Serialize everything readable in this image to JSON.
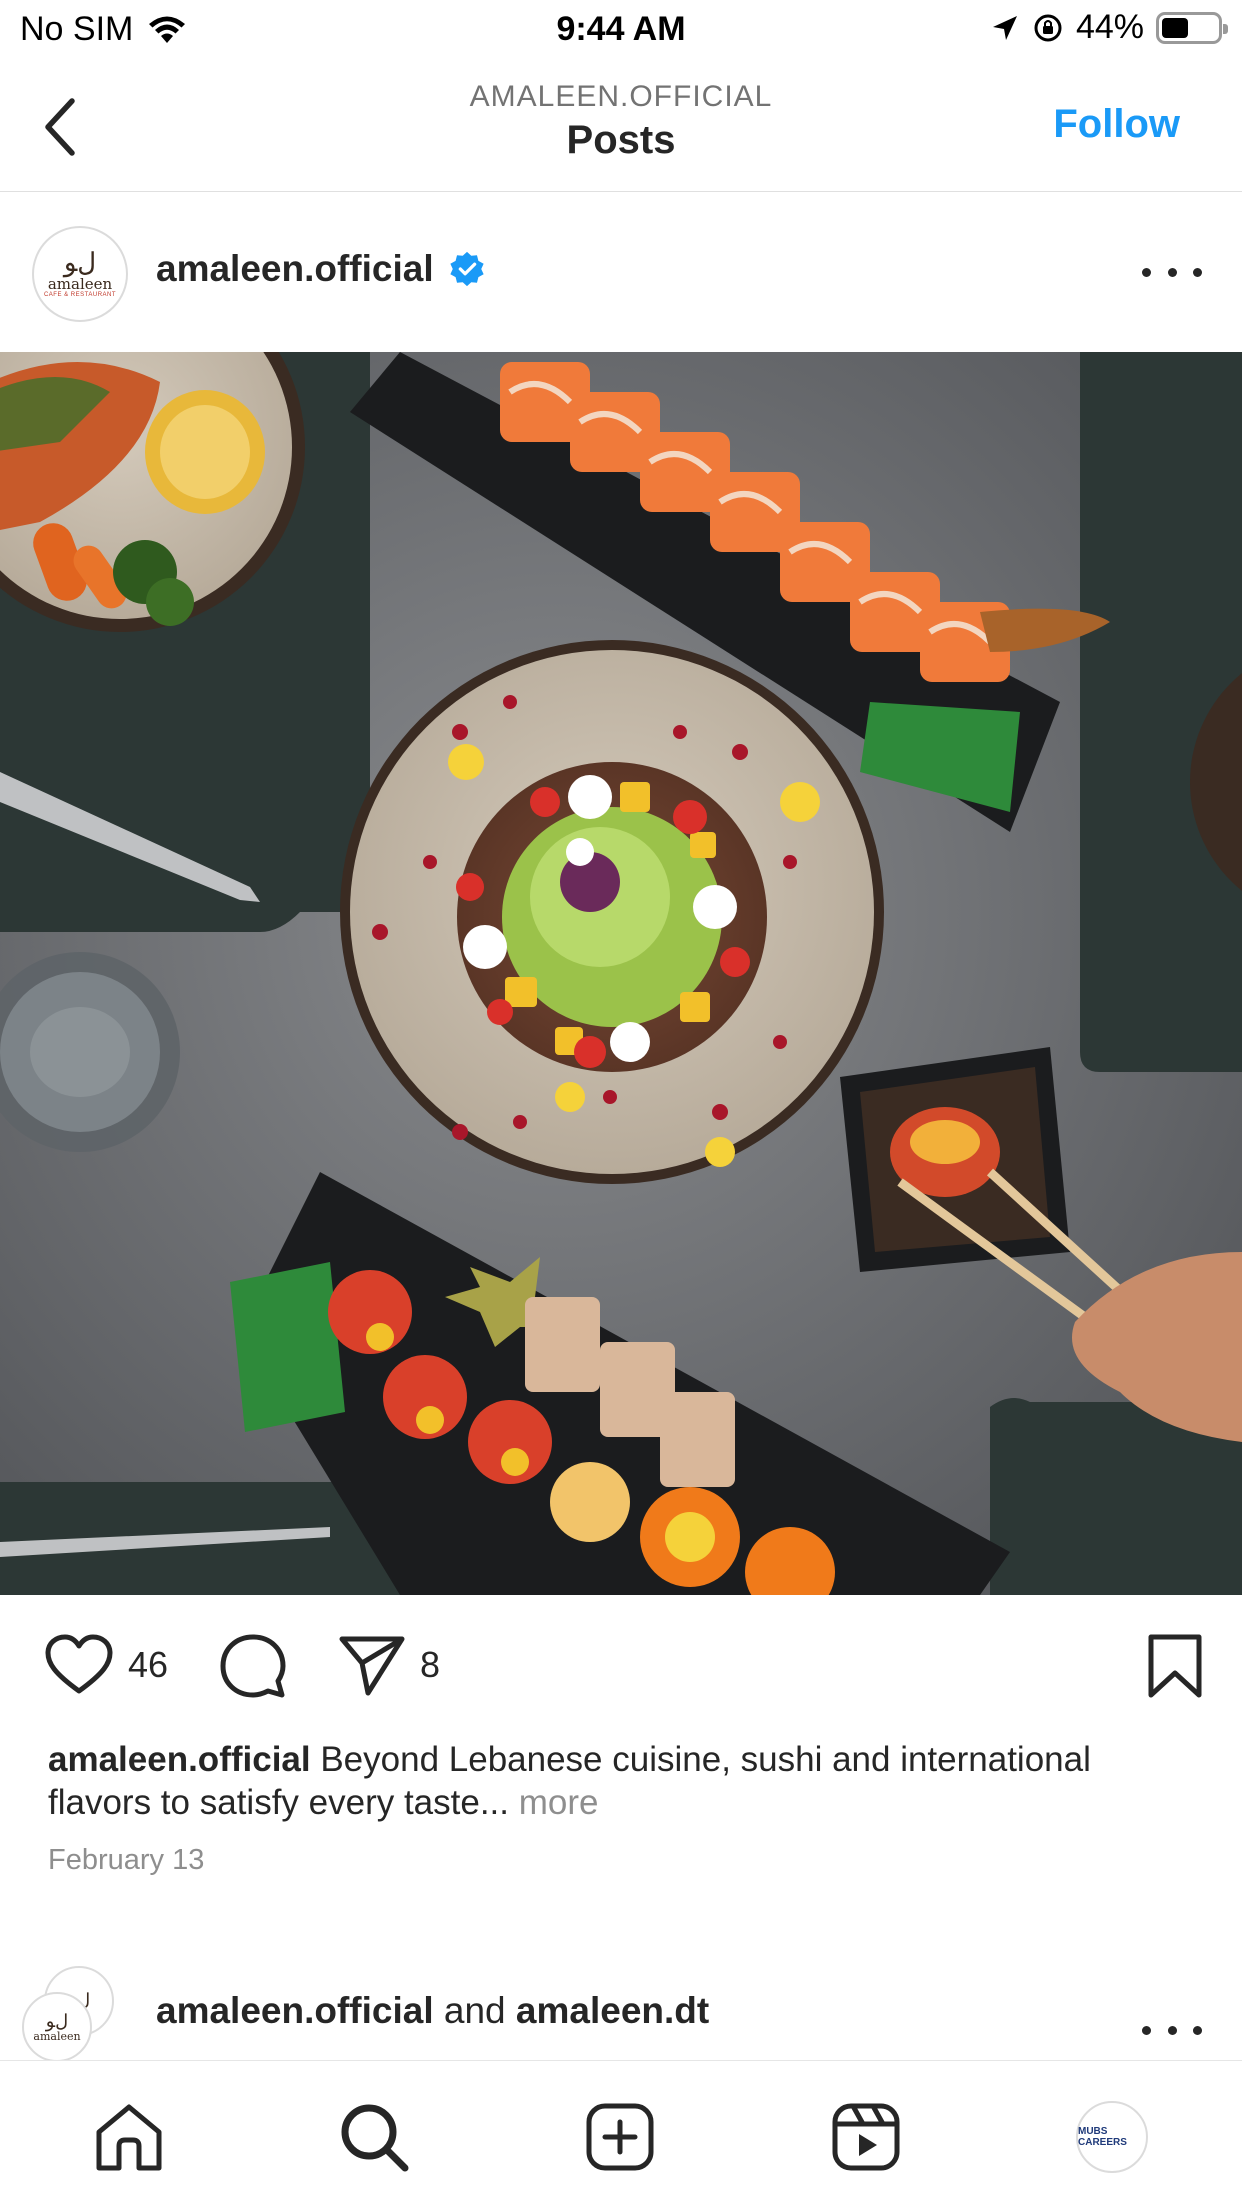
{
  "status_bar": {
    "carrier": "No SIM",
    "time": "9:44 AM",
    "battery": "44%",
    "battery_level": 0.44
  },
  "header": {
    "account": "AMALEEN.OFFICIAL",
    "title": "Posts",
    "follow_label": "Follow",
    "accent_color": "#1a9af7"
  },
  "post": {
    "username": "amaleen.official",
    "avatar_text": "amaleen",
    "avatar_subtext": "CAFE & RESTAURANT",
    "likes": "46",
    "shares": "8",
    "caption_user": "amaleen.official",
    "caption_text": " Beyond Lebanese cuisine, sushi and international flavors to satisfy every taste...",
    "caption_more": " more",
    "date": "February 13"
  },
  "next_post": {
    "user1": "amaleen.official",
    "connector": " and ",
    "user2": "amaleen.dt"
  },
  "tab_bar": {
    "profile_text": "MUBS CAREERS"
  },
  "icons": [
    "wifi-icon",
    "location-icon",
    "orientation-lock-icon",
    "battery-icon",
    "back-chevron-icon",
    "verified-badge-icon",
    "more-icon",
    "heart-icon",
    "comment-icon",
    "send-icon",
    "bookmark-icon",
    "home-icon",
    "search-icon",
    "create-icon",
    "reels-icon",
    "profile-icon"
  ]
}
